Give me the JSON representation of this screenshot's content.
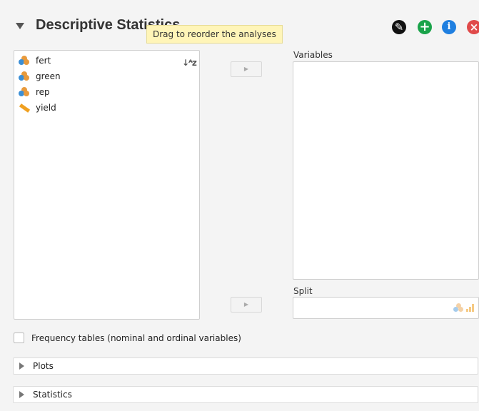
{
  "header": {
    "title": "Descriptive Statistics",
    "tooltip": "Drag to reorder the analyses",
    "icons": [
      "edit-icon",
      "add-icon",
      "info-icon",
      "remove-icon"
    ],
    "colors": {
      "add": "#1aa34a",
      "info": "#1f7fe0",
      "remove": "#e04a4a",
      "edit": "#111111"
    }
  },
  "source_list": {
    "items": [
      {
        "label": "fert",
        "icon": "nominal-variable-icon"
      },
      {
        "label": "green",
        "icon": "nominal-variable-icon"
      },
      {
        "label": "rep",
        "icon": "nominal-variable-icon"
      },
      {
        "label": "yield",
        "icon": "continuous-variable-icon"
      }
    ],
    "sort_icon": "sort-icon"
  },
  "targets": {
    "variables_label": "Variables",
    "split_label": "Split"
  },
  "options": {
    "frequency_tables_label": "Frequency tables (nominal and ordinal variables)",
    "frequency_tables_checked": false
  },
  "sections": {
    "plots": "Plots",
    "statistics": "Statistics"
  }
}
